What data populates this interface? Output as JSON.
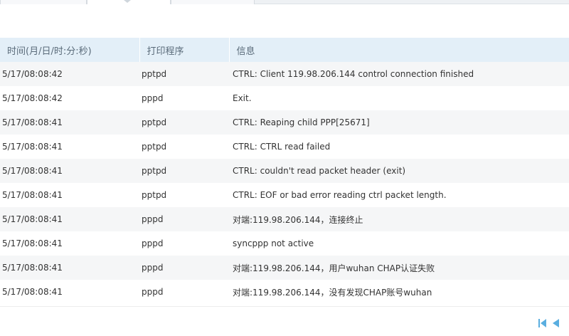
{
  "table": {
    "headers": {
      "time": "时间(月/日/时:分:秒)",
      "program": "打印程序",
      "message": "信息"
    },
    "rows": [
      {
        "time": "5/17/08:08:42",
        "program": "pptpd",
        "message": "CTRL: Client 119.98.206.144 control connection finished"
      },
      {
        "time": "5/17/08:08:42",
        "program": "pppd",
        "message": "Exit."
      },
      {
        "time": "5/17/08:08:41",
        "program": "pptpd",
        "message": "CTRL: Reaping child PPP[25671]"
      },
      {
        "time": "5/17/08:08:41",
        "program": "pptpd",
        "message": "CTRL: CTRL read failed"
      },
      {
        "time": "5/17/08:08:41",
        "program": "pptpd",
        "message": "CTRL: couldn't read packet header (exit)"
      },
      {
        "time": "5/17/08:08:41",
        "program": "pptpd",
        "message": "CTRL: EOF or bad error reading ctrl packet length."
      },
      {
        "time": "5/17/08:08:41",
        "program": "pppd",
        "message": "对端:119.98.206.144，连接终止"
      },
      {
        "time": "5/17/08:08:41",
        "program": "pppd",
        "message": "syncppp not active"
      },
      {
        "time": "5/17/08:08:41",
        "program": "pppd",
        "message": "对端:119.98.206.144，用户wuhan CHAP认证失败"
      },
      {
        "time": "5/17/08:08:41",
        "program": "pppd",
        "message": "对端:119.98.206.144，没有发现CHAP账号wuhan"
      }
    ]
  },
  "pager": {
    "first_icon": "first-page-icon",
    "prev_icon": "prev-page-icon",
    "color": "#5aaee0"
  }
}
